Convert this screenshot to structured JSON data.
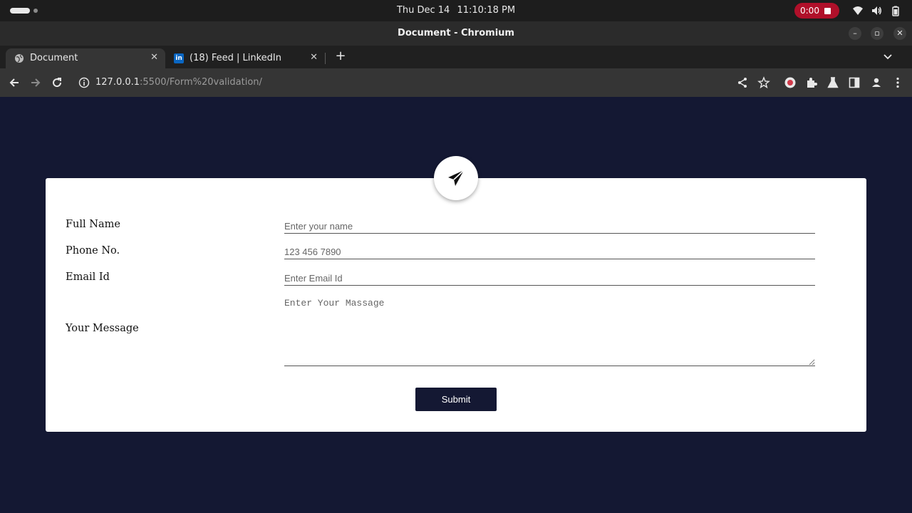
{
  "system_bar": {
    "day": "Thu Dec 14",
    "time": "11:10:18 PM",
    "recording_time": "0:00"
  },
  "window": {
    "title": "Document - Chromium"
  },
  "tabs": [
    {
      "label": "Document",
      "active": true
    },
    {
      "label": "(18) Feed | LinkedIn",
      "active": false
    }
  ],
  "omnibox": {
    "host": "127.0.0.1",
    "path": ":5500/Form%20validation/"
  },
  "form": {
    "full_name": {
      "label": "Full Name",
      "placeholder": "Enter your name"
    },
    "phone": {
      "label": "Phone No.",
      "placeholder": "123 456 7890"
    },
    "email": {
      "label": "Email Id",
      "placeholder": "Enter Email Id"
    },
    "message": {
      "label": "Your Message",
      "placeholder": "Enter Your Massage"
    },
    "submit_label": "Submit"
  },
  "colors": {
    "page_background": "#141833",
    "card_background": "#ffffff",
    "button_background": "#141833",
    "record_indicator": "#b0102a"
  },
  "icons": {
    "badge": "paper-plane-icon",
    "linkedin_tab": "linkedin-icon",
    "document_tab": "globe-icon"
  }
}
